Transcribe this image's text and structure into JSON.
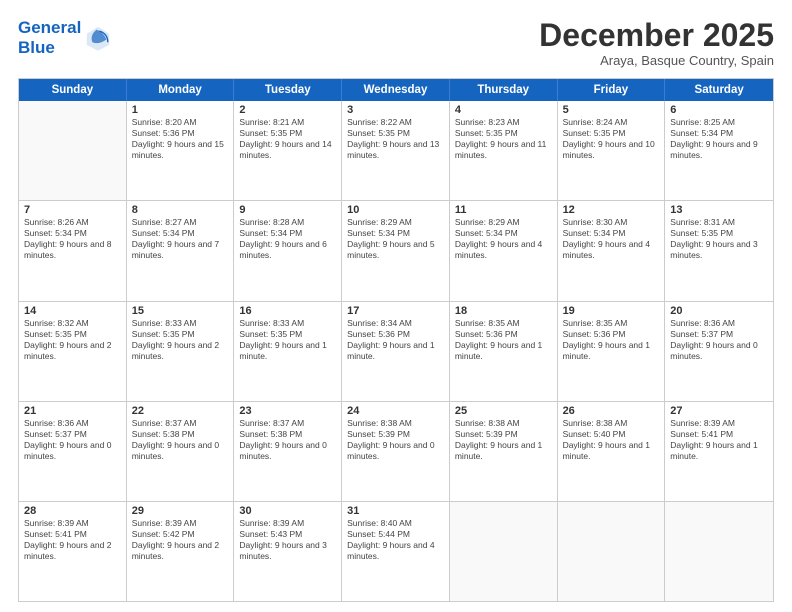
{
  "logo": {
    "line1": "General",
    "line2": "Blue"
  },
  "header": {
    "month": "December 2025",
    "location": "Araya, Basque Country, Spain"
  },
  "weekdays": [
    "Sunday",
    "Monday",
    "Tuesday",
    "Wednesday",
    "Thursday",
    "Friday",
    "Saturday"
  ],
  "weeks": [
    [
      {
        "day": "",
        "sunrise": "",
        "sunset": "",
        "daylight": ""
      },
      {
        "day": "1",
        "sunrise": "Sunrise: 8:20 AM",
        "sunset": "Sunset: 5:36 PM",
        "daylight": "Daylight: 9 hours and 15 minutes."
      },
      {
        "day": "2",
        "sunrise": "Sunrise: 8:21 AM",
        "sunset": "Sunset: 5:35 PM",
        "daylight": "Daylight: 9 hours and 14 minutes."
      },
      {
        "day": "3",
        "sunrise": "Sunrise: 8:22 AM",
        "sunset": "Sunset: 5:35 PM",
        "daylight": "Daylight: 9 hours and 13 minutes."
      },
      {
        "day": "4",
        "sunrise": "Sunrise: 8:23 AM",
        "sunset": "Sunset: 5:35 PM",
        "daylight": "Daylight: 9 hours and 11 minutes."
      },
      {
        "day": "5",
        "sunrise": "Sunrise: 8:24 AM",
        "sunset": "Sunset: 5:35 PM",
        "daylight": "Daylight: 9 hours and 10 minutes."
      },
      {
        "day": "6",
        "sunrise": "Sunrise: 8:25 AM",
        "sunset": "Sunset: 5:34 PM",
        "daylight": "Daylight: 9 hours and 9 minutes."
      }
    ],
    [
      {
        "day": "7",
        "sunrise": "Sunrise: 8:26 AM",
        "sunset": "Sunset: 5:34 PM",
        "daylight": "Daylight: 9 hours and 8 minutes."
      },
      {
        "day": "8",
        "sunrise": "Sunrise: 8:27 AM",
        "sunset": "Sunset: 5:34 PM",
        "daylight": "Daylight: 9 hours and 7 minutes."
      },
      {
        "day": "9",
        "sunrise": "Sunrise: 8:28 AM",
        "sunset": "Sunset: 5:34 PM",
        "daylight": "Daylight: 9 hours and 6 minutes."
      },
      {
        "day": "10",
        "sunrise": "Sunrise: 8:29 AM",
        "sunset": "Sunset: 5:34 PM",
        "daylight": "Daylight: 9 hours and 5 minutes."
      },
      {
        "day": "11",
        "sunrise": "Sunrise: 8:29 AM",
        "sunset": "Sunset: 5:34 PM",
        "daylight": "Daylight: 9 hours and 4 minutes."
      },
      {
        "day": "12",
        "sunrise": "Sunrise: 8:30 AM",
        "sunset": "Sunset: 5:34 PM",
        "daylight": "Daylight: 9 hours and 4 minutes."
      },
      {
        "day": "13",
        "sunrise": "Sunrise: 8:31 AM",
        "sunset": "Sunset: 5:35 PM",
        "daylight": "Daylight: 9 hours and 3 minutes."
      }
    ],
    [
      {
        "day": "14",
        "sunrise": "Sunrise: 8:32 AM",
        "sunset": "Sunset: 5:35 PM",
        "daylight": "Daylight: 9 hours and 2 minutes."
      },
      {
        "day": "15",
        "sunrise": "Sunrise: 8:33 AM",
        "sunset": "Sunset: 5:35 PM",
        "daylight": "Daylight: 9 hours and 2 minutes."
      },
      {
        "day": "16",
        "sunrise": "Sunrise: 8:33 AM",
        "sunset": "Sunset: 5:35 PM",
        "daylight": "Daylight: 9 hours and 1 minute."
      },
      {
        "day": "17",
        "sunrise": "Sunrise: 8:34 AM",
        "sunset": "Sunset: 5:36 PM",
        "daylight": "Daylight: 9 hours and 1 minute."
      },
      {
        "day": "18",
        "sunrise": "Sunrise: 8:35 AM",
        "sunset": "Sunset: 5:36 PM",
        "daylight": "Daylight: 9 hours and 1 minute."
      },
      {
        "day": "19",
        "sunrise": "Sunrise: 8:35 AM",
        "sunset": "Sunset: 5:36 PM",
        "daylight": "Daylight: 9 hours and 1 minute."
      },
      {
        "day": "20",
        "sunrise": "Sunrise: 8:36 AM",
        "sunset": "Sunset: 5:37 PM",
        "daylight": "Daylight: 9 hours and 0 minutes."
      }
    ],
    [
      {
        "day": "21",
        "sunrise": "Sunrise: 8:36 AM",
        "sunset": "Sunset: 5:37 PM",
        "daylight": "Daylight: 9 hours and 0 minutes."
      },
      {
        "day": "22",
        "sunrise": "Sunrise: 8:37 AM",
        "sunset": "Sunset: 5:38 PM",
        "daylight": "Daylight: 9 hours and 0 minutes."
      },
      {
        "day": "23",
        "sunrise": "Sunrise: 8:37 AM",
        "sunset": "Sunset: 5:38 PM",
        "daylight": "Daylight: 9 hours and 0 minutes."
      },
      {
        "day": "24",
        "sunrise": "Sunrise: 8:38 AM",
        "sunset": "Sunset: 5:39 PM",
        "daylight": "Daylight: 9 hours and 0 minutes."
      },
      {
        "day": "25",
        "sunrise": "Sunrise: 8:38 AM",
        "sunset": "Sunset: 5:39 PM",
        "daylight": "Daylight: 9 hours and 1 minute."
      },
      {
        "day": "26",
        "sunrise": "Sunrise: 8:38 AM",
        "sunset": "Sunset: 5:40 PM",
        "daylight": "Daylight: 9 hours and 1 minute."
      },
      {
        "day": "27",
        "sunrise": "Sunrise: 8:39 AM",
        "sunset": "Sunset: 5:41 PM",
        "daylight": "Daylight: 9 hours and 1 minute."
      }
    ],
    [
      {
        "day": "28",
        "sunrise": "Sunrise: 8:39 AM",
        "sunset": "Sunset: 5:41 PM",
        "daylight": "Daylight: 9 hours and 2 minutes."
      },
      {
        "day": "29",
        "sunrise": "Sunrise: 8:39 AM",
        "sunset": "Sunset: 5:42 PM",
        "daylight": "Daylight: 9 hours and 2 minutes."
      },
      {
        "day": "30",
        "sunrise": "Sunrise: 8:39 AM",
        "sunset": "Sunset: 5:43 PM",
        "daylight": "Daylight: 9 hours and 3 minutes."
      },
      {
        "day": "31",
        "sunrise": "Sunrise: 8:40 AM",
        "sunset": "Sunset: 5:44 PM",
        "daylight": "Daylight: 9 hours and 4 minutes."
      },
      {
        "day": "",
        "sunrise": "",
        "sunset": "",
        "daylight": ""
      },
      {
        "day": "",
        "sunrise": "",
        "sunset": "",
        "daylight": ""
      },
      {
        "day": "",
        "sunrise": "",
        "sunset": "",
        "daylight": ""
      }
    ]
  ]
}
